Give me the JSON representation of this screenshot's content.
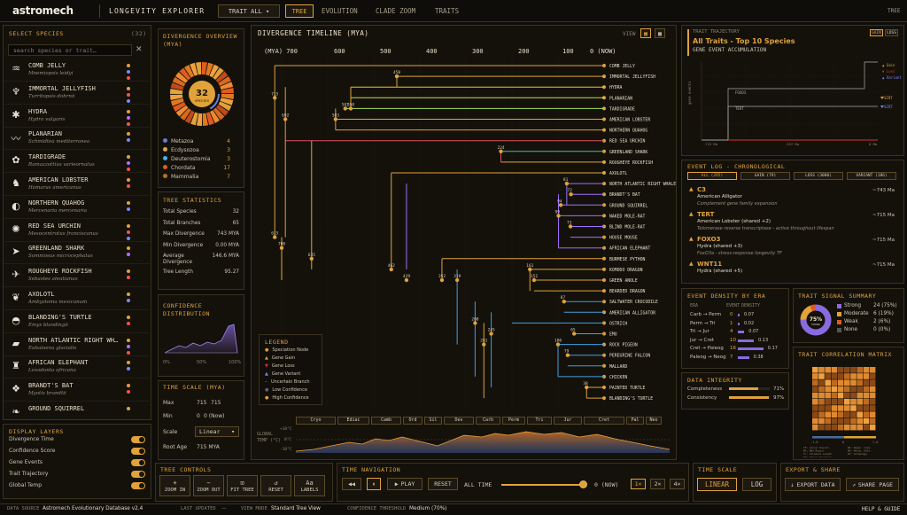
{
  "app": {
    "logo": "astromech",
    "title": "LONGEVITY EXPLORER",
    "dropdown": "TRAIT ALL ▾",
    "tabs": [
      "TREE",
      "EVOLUTION",
      "CLADE ZOOM",
      "TRAITS"
    ],
    "right_tab": "TREE"
  },
  "species_panel": {
    "title": "SELECT SPECIES",
    "count": "(32)",
    "search_placeholder": "search species or trait…",
    "items": [
      {
        "name": "COMB JELLY",
        "sci": "Mnemiopsis leidyi",
        "icon": "comb-jelly-icon",
        "dots": [
          "#e0a23a",
          "#7a8aff",
          "#ff5050"
        ]
      },
      {
        "name": "IMMORTAL JELLYFISH",
        "sci": "Turritopsis dohrnii",
        "icon": "jellyfish-icon",
        "dots": [
          "#e0a23a",
          "#ff5050",
          "#7a8aff"
        ]
      },
      {
        "name": "HYDRA",
        "sci": "Hydra vulgaris",
        "icon": "hydra-icon",
        "dots": [
          "#e0a23a",
          "#b070ff",
          "#ff5050"
        ]
      },
      {
        "name": "PLANARIAN",
        "sci": "Schmidtea mediterranea",
        "icon": "planarian-icon",
        "dots": [
          "#e0a23a",
          "#7a8aff"
        ]
      },
      {
        "name": "TARDIGRADE",
        "sci": "Ramazzottius varieornatus",
        "icon": "tardigrade-icon",
        "dots": [
          "#e0a23a",
          "#b070ff",
          "#ff5050"
        ]
      },
      {
        "name": "AMERICAN LOBSTER",
        "sci": "Homarus americanus",
        "icon": "lobster-icon",
        "dots": [
          "#e0a23a",
          "#ff5050"
        ]
      },
      {
        "name": "NORTHERN QUAHOG",
        "sci": "Mercenaria mercenaria",
        "icon": "clam-icon",
        "dots": [
          "#e0a23a",
          "#7a8aff"
        ]
      },
      {
        "name": "RED SEA URCHIN",
        "sci": "Mesocentrotus franciscanus",
        "icon": "urchin-icon",
        "dots": [
          "#e0a23a",
          "#ff5050",
          "#7a8aff"
        ]
      },
      {
        "name": "GREENLAND SHARK",
        "sci": "Somniosus microcephalus",
        "icon": "shark-icon",
        "dots": [
          "#e0a23a",
          "#b070ff"
        ]
      },
      {
        "name": "ROUGHEYE ROCKFISH",
        "sci": "Sebastes aleutianus",
        "icon": "fish-icon",
        "dots": [
          "#e0a23a",
          "#ff5050"
        ]
      },
      {
        "name": "AXOLOTL",
        "sci": "Ambystoma mexicanum",
        "icon": "axolotl-icon",
        "dots": [
          "#e0a23a",
          "#7a8aff"
        ]
      },
      {
        "name": "BLANDING'S TURTLE",
        "sci": "Emys blandingii",
        "icon": "turtle-icon",
        "dots": [
          "#e0a23a",
          "#ff5050"
        ]
      },
      {
        "name": "NORTH ATLANTIC RIGHT WH…",
        "sci": "Eubalaena glacialis",
        "icon": "whale-icon",
        "dots": [
          "#e0a23a",
          "#b070ff",
          "#ff5050"
        ]
      },
      {
        "name": "AFRICAN ELEPHANT",
        "sci": "Loxodonta africana",
        "icon": "elephant-icon",
        "dots": [
          "#e0a23a",
          "#7a8aff"
        ]
      },
      {
        "name": "BRANDT'S BAT",
        "sci": "Myotis brandtii",
        "icon": "bat-icon",
        "dots": [
          "#e0a23a",
          "#ff5050"
        ]
      },
      {
        "name": "GROUND SQUIRREL",
        "sci": "",
        "icon": "squirrel-icon",
        "dots": [
          "#e0a23a"
        ]
      }
    ]
  },
  "display_layers": {
    "title": "DISPLAY LAYERS",
    "items": [
      "Divergence Time",
      "Confidence Score",
      "Gene Events",
      "Trait Trajectory",
      "Global Temp"
    ]
  },
  "divergence": {
    "title": "DIVERGENCE OVERVIEW (MYA)",
    "center_value": "32",
    "center_label": "SPECIES",
    "legend": [
      {
        "label": "Metazoa",
        "value": "4",
        "color": "#6a7ad8"
      },
      {
        "label": "Ecdysozoa",
        "value": "3",
        "color": "#e0a23a"
      },
      {
        "label": "Deuterostomia",
        "value": "3",
        "color": "#4ab0e0"
      },
      {
        "label": "Chordata",
        "value": "17",
        "color": "#e05a20"
      },
      {
        "label": "Mammalia",
        "value": "7",
        "color": "#b07030"
      }
    ]
  },
  "tree_stats": {
    "title": "TREE STATISTICS",
    "rows": [
      {
        "label": "Total Species",
        "value": "32"
      },
      {
        "label": "Total Branches",
        "value": "65"
      },
      {
        "label": "Max Divergence",
        "value": "743 MYA"
      },
      {
        "label": "Min Divergence",
        "value": "0.00 MYA"
      },
      {
        "label": "Average Divergence",
        "value": "146.6 MYA"
      },
      {
        "label": "Tree Length",
        "value": "95.27"
      }
    ]
  },
  "confidence": {
    "title": "CONFIDENCE DISTRIBUTION",
    "ticks": [
      "0%",
      "50%",
      "100%"
    ]
  },
  "time_scale_left": {
    "title": "TIME SCALE (MYA)",
    "max_label": "Max",
    "max": "715",
    "max2": "715",
    "min_label": "Min",
    "min": "0",
    "min2": "0 (Now)",
    "scale_label": "Scale",
    "scale": "Linear",
    "root_label": "Root Age",
    "root": "715 MYA"
  },
  "timeline": {
    "title": "DIVERGENCE TIMELINE (MYA)",
    "view": "VIEW",
    "axis": [
      "(MYA) 700",
      "600",
      "500",
      "400",
      "300",
      "200",
      "100",
      "0 (NOW)"
    ],
    "species": [
      "COMB JELLY",
      "IMMORTAL JELLYFISH",
      "HYDRA",
      "PLANARIAN",
      "TARDIGRADE",
      "AMERICAN LOBSTER",
      "NORTHERN QUAHOG",
      "RED SEA URCHIN",
      "GREENLAND SHARK",
      "ROUGHEYE ROCKFISH",
      "AXOLOTL",
      "NORTH ATLANTIC RIGHT WHALE",
      "BRANDT'S BAT",
      "GROUND SQUIRREL",
      "NAKED MOLE-RAT",
      "BLIND MOLE-RAT",
      "HOUSE MOUSE",
      "AFRICAN ELEPHANT",
      "BURMESE PYTHON",
      "KOMODO DRAGON",
      "GREEN ANOLE",
      "BEARDED DRAGON",
      "SALTWATER CROCODILE",
      "AMERICAN ALLIGATOR",
      "OSTRICH",
      "EMU",
      "ROCK PIGEON",
      "PEREGRINE FALCON",
      "MALLARD",
      "CHICKEN",
      "PAINTED TURTLE",
      "BLANDING'S TURTLE"
    ],
    "node_labels": [
      "715",
      "450",
      "692",
      "550",
      "583",
      "562",
      "224",
      "81",
      "94",
      "99",
      "72",
      "73",
      "615",
      "700",
      "635",
      "462",
      "429",
      "352",
      "319",
      "161",
      "152",
      "87",
      "65",
      "200",
      "245",
      "261",
      "180",
      "79",
      "38"
    ],
    "legend": {
      "title": "LEGEND",
      "items": [
        "Speciation Node",
        "Gene Gain",
        "Gene Loss",
        "Gene Variant",
        "Uncertain Branch",
        "Low Confidence",
        "High Confidence"
      ]
    },
    "eras": [
      "Cryo",
      "Ediac",
      "Camb",
      "Ord",
      "Sil",
      "Dev",
      "Carb",
      "Perm",
      "Tri",
      "Jur",
      "Cret",
      "Pal",
      "Neo"
    ],
    "temp_label": "GLOBAL TEMP (°C)",
    "temp_ticks": [
      "+10°C",
      "0°C",
      "-10°C"
    ]
  },
  "trait_traj": {
    "title": "TRAIT TRAJECTORY",
    "subtitle": "All Traits - Top 10 Species",
    "sub2": "GENE EVENT ACCUMULATION",
    "badges": [
      "GAIN",
      "LOSS"
    ],
    "legend": [
      "Gain",
      "Loss",
      "Variant"
    ],
    "labels": [
      "FOXO3",
      "TERT",
      "SIRT",
      "SIRT"
    ],
    "ylabel": "gene events",
    "xticks": [
      "-715 Ma",
      "-357 Ma",
      "0 Ma"
    ]
  },
  "event_log": {
    "title": "EVENT LOG - CHRONOLOGICAL",
    "tabs": [
      "ALL (295)",
      "GAIN (79)",
      "LOSS (3000)",
      "VARIANT (186)"
    ],
    "events": [
      {
        "gene": "C3",
        "species": "American Alligator",
        "desc": "Complement gene family expansion",
        "time": "~743 Ma"
      },
      {
        "gene": "TERT",
        "species": "American Lobster (shared +2)",
        "desc": "Telomerase reverse transcriptase - active throughout lifespan",
        "time": "~715 Ma"
      },
      {
        "gene": "FOXO3",
        "species": "Hydra (shared +3)",
        "desc": "FoxO3a - stress-response longevity TF",
        "time": "~715 Ma"
      },
      {
        "gene": "WNT11",
        "species": "Hydra (shared +5)",
        "desc": "",
        "time": "~715 Ma"
      }
    ]
  },
  "density": {
    "title": "EVENT DENSITY BY ERA",
    "cols": [
      "ERA",
      "EVENT",
      "DENSITY"
    ],
    "rows": [
      {
        "era": "Carb → Perm",
        "n": "0",
        "d": "0.07"
      },
      {
        "era": "Perm → Tri",
        "n": "1",
        "d": "0.02"
      },
      {
        "era": "Tri → Jur",
        "n": "4",
        "d": "0.07"
      },
      {
        "era": "Jur → Cret",
        "n": "10",
        "d": "0.13"
      },
      {
        "era": "Cret → Paleog",
        "n": "16",
        "d": "0.17"
      },
      {
        "era": "Paleog → Neog",
        "n": "7",
        "d": "0.38"
      }
    ]
  },
  "signal": {
    "title": "TRAIT SIGNAL SUMMARY",
    "center": "75%",
    "center_sub": "STRONG",
    "rows": [
      {
        "label": "Strong",
        "value": "24 (75%)",
        "color": "#8a6ae0"
      },
      {
        "label": "Moderate",
        "value": "6 (19%)",
        "color": "#e0a23a"
      },
      {
        "label": "Weak",
        "value": "2 (6%)",
        "color": "#e05a20"
      },
      {
        "label": "None",
        "value": "0 (0%)",
        "color": "#555"
      }
    ]
  },
  "integrity": {
    "title": "DATA INTEGRITY",
    "rows": [
      {
        "label": "Completeness",
        "value": "71%"
      },
      {
        "label": "Consistency",
        "value": "97%"
      }
    ]
  },
  "matrix": {
    "title": "TRAIT CORRELATION MATRIX",
    "ticks": [
      "-1.0",
      "0",
      "1.0"
    ],
    "footer": [
      "TE: Cancer Resist.",
      "RD: Regen. Capa.",
      "DR: DNA Repair",
      "MR: Metab. Rate",
      "TL: Telomere Length",
      "AP: Autophagy",
      "IM: Immune Function"
    ]
  },
  "tree_controls": {
    "title": "TREE CONTROLS",
    "buttons": [
      "ZOOM IN",
      "ZOOM OUT",
      "FIT TREE",
      "RESET",
      "LABELS"
    ]
  },
  "time_nav": {
    "title": "TIME NAVIGATION",
    "play": "PLAY",
    "reset": "RESET",
    "all_time": "ALL TIME",
    "now": "0 (NOW)",
    "speeds": [
      "1×",
      "2×",
      "4×"
    ]
  },
  "time_scale_bottom": {
    "title": "TIME SCALE",
    "linear": "LINEAR",
    "log": "LOG"
  },
  "export": {
    "title": "EXPORT & SHARE",
    "export": "EXPORT DATA",
    "share": "SHARE PAGE"
  },
  "status": {
    "source_label": "DATA SOURCE",
    "source": "Astromech Evolutionary Database v2.4",
    "updated_label": "LAST UPDATED",
    "updated": "—",
    "mode_label": "VIEW MODE",
    "mode": "Standard Tree View",
    "thresh_label": "CONFIDENCE THRESHOLD",
    "thresh": "Medium (70%)",
    "help": "HELP & GUIDE"
  },
  "colors": {
    "accent": "#e0a23a",
    "bg": "#0f0d09",
    "panel": "#14110b",
    "border": "#3a3220"
  }
}
